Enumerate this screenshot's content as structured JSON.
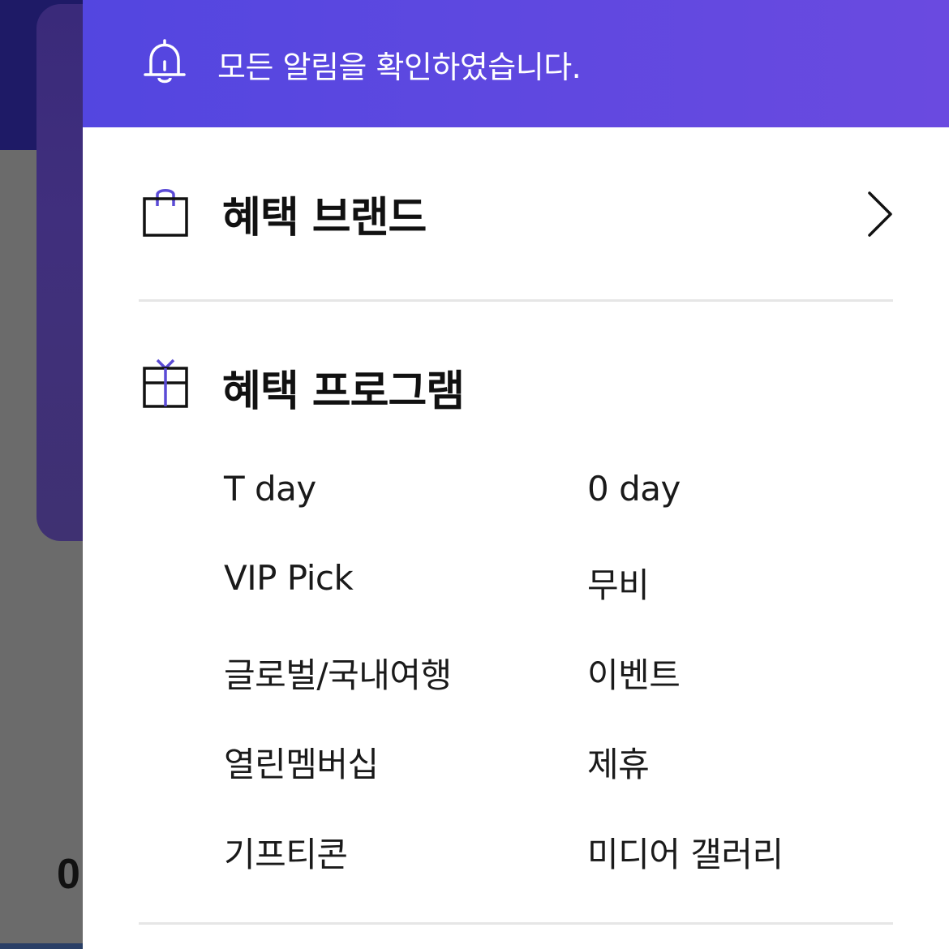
{
  "background": {
    "partial_text": "0"
  },
  "notice": {
    "icon": "bell-icon",
    "text": "모든 알림을 확인하였습니다."
  },
  "brand_section": {
    "icon": "shopping-bag-icon",
    "title": "혜택 브랜드",
    "chevron_icon": "chevron-right-icon"
  },
  "program_section": {
    "icon": "gift-icon",
    "title": "혜택 프로그램",
    "left_items": [
      "T day",
      "VIP Pick",
      "글로벌/국내여행",
      "열린멤버십",
      "기프티콘"
    ],
    "right_items": [
      "0 day",
      "무비",
      "이벤트",
      "제휴",
      "미디어 갤러리"
    ]
  },
  "colors": {
    "accent": "#5346e0",
    "icon_accent": "#5b4bd6"
  }
}
